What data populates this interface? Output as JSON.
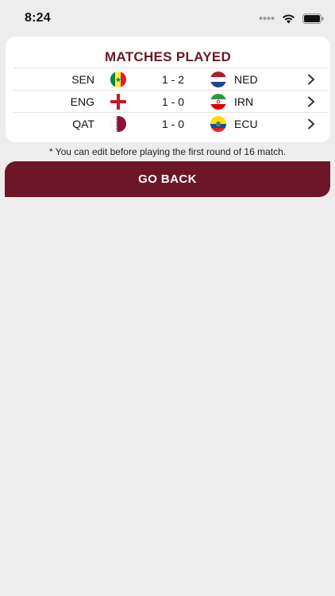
{
  "status_bar": {
    "time": "8:24",
    "icons": [
      "signal-dots-icon",
      "wifi-icon",
      "battery-icon"
    ]
  },
  "card": {
    "title": "MATCHES PLAYED",
    "matches": [
      {
        "home": "SEN",
        "home_flag": "senegal-flag-icon",
        "score": "1 - 2",
        "away": "NED",
        "away_flag": "netherlands-flag-icon"
      },
      {
        "home": "ENG",
        "home_flag": "england-flag-icon",
        "score": "1 - 0",
        "away": "IRN",
        "away_flag": "iran-flag-icon"
      },
      {
        "home": "QAT",
        "home_flag": "qatar-flag-icon",
        "score": "1 - 0",
        "away": "ECU",
        "away_flag": "ecuador-flag-icon"
      }
    ]
  },
  "note": "* You can edit before playing the first round of 16 match.",
  "go_back_label": "GO BACK",
  "colors": {
    "brand": "#6d1628",
    "background": "#eeeded",
    "card": "#ffffff"
  }
}
